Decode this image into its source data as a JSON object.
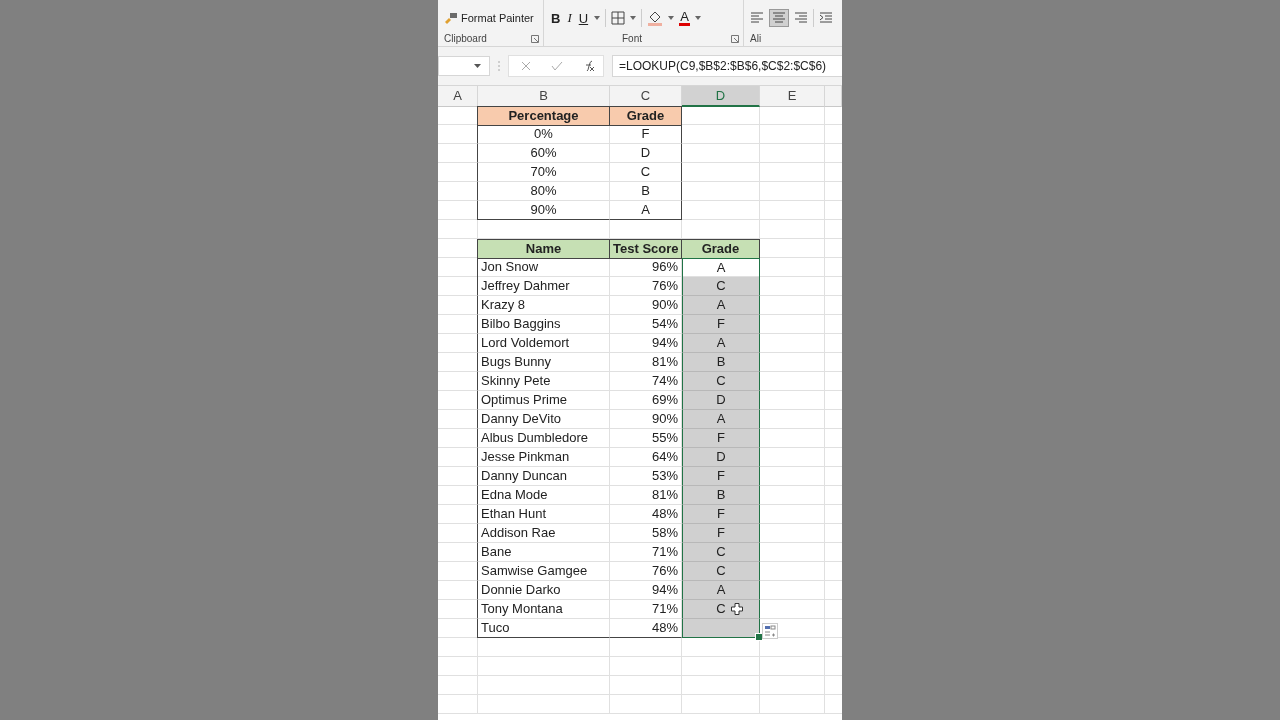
{
  "ribbon": {
    "clipboard": {
      "label": "Clipboard",
      "format_painter": "Format Painter"
    },
    "font": {
      "label": "Font",
      "bold": "B",
      "italic": "I",
      "underline": "U",
      "font_color": "A"
    },
    "alignment": {
      "label": "Ali",
      "center_selected": true
    }
  },
  "formula_bar": {
    "formula": "=LOOKUP(C9,$B$2:$B$6,$C$2:$C$6)"
  },
  "columns": [
    {
      "label": "A",
      "selected": false
    },
    {
      "label": "B",
      "selected": false
    },
    {
      "label": "C",
      "selected": false
    },
    {
      "label": "D",
      "selected": true
    },
    {
      "label": "E",
      "selected": false
    }
  ],
  "lookup_table": {
    "headers": [
      "Percentage",
      "Grade"
    ],
    "rows": [
      {
        "percentage": "0%",
        "grade": "F"
      },
      {
        "percentage": "60%",
        "grade": "D"
      },
      {
        "percentage": "70%",
        "grade": "C"
      },
      {
        "percentage": "80%",
        "grade": "B"
      },
      {
        "percentage": "90%",
        "grade": "A"
      }
    ]
  },
  "score_table": {
    "headers": [
      "Name",
      "Test Score",
      "Grade"
    ],
    "rows": [
      {
        "name": "Jon Snow",
        "score": "96%",
        "grade": "A",
        "selected": false
      },
      {
        "name": "Jeffrey Dahmer",
        "score": "76%",
        "grade": "C",
        "selected": true
      },
      {
        "name": "Krazy 8",
        "score": "90%",
        "grade": "A",
        "selected": true
      },
      {
        "name": "Bilbo Baggins",
        "score": "54%",
        "grade": "F",
        "selected": true
      },
      {
        "name": "Lord Voldemort",
        "score": "94%",
        "grade": "A",
        "selected": true
      },
      {
        "name": "Bugs Bunny",
        "score": "81%",
        "grade": "B",
        "selected": true
      },
      {
        "name": "Skinny Pete",
        "score": "74%",
        "grade": "C",
        "selected": true
      },
      {
        "name": "Optimus Prime",
        "score": "69%",
        "grade": "D",
        "selected": true
      },
      {
        "name": "Danny DeVito",
        "score": "90%",
        "grade": "A",
        "selected": true
      },
      {
        "name": "Albus Dumbledore",
        "score": "55%",
        "grade": "F",
        "selected": true
      },
      {
        "name": "Jesse Pinkman",
        "score": "64%",
        "grade": "D",
        "selected": true
      },
      {
        "name": "Danny Duncan",
        "score": "53%",
        "grade": "F",
        "selected": true
      },
      {
        "name": "Edna Mode",
        "score": "81%",
        "grade": "B",
        "selected": true
      },
      {
        "name": "Ethan Hunt",
        "score": "48%",
        "grade": "F",
        "selected": true
      },
      {
        "name": "Addison Rae",
        "score": "58%",
        "grade": "F",
        "selected": true
      },
      {
        "name": "Bane",
        "score": "71%",
        "grade": "C",
        "selected": true
      },
      {
        "name": "Samwise Gamgee",
        "score": "76%",
        "grade": "C",
        "selected": true
      },
      {
        "name": "Donnie Darko",
        "score": "94%",
        "grade": "A",
        "selected": true
      },
      {
        "name": "Tony Montana",
        "score": "71%",
        "grade": "C",
        "selected": true
      },
      {
        "name": "Tuco",
        "score": "48%",
        "selected": true
      }
    ]
  }
}
